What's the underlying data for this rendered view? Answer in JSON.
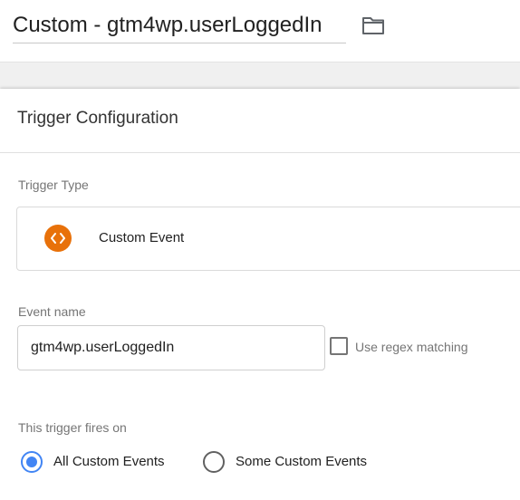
{
  "header": {
    "trigger_name": "Custom - gtm4wp.userLoggedIn",
    "folder_icon": "folder-icon"
  },
  "card": {
    "title": "Trigger Configuration",
    "trigger_type": {
      "label": "Trigger Type",
      "value": "Custom Event",
      "icon": "code-brackets-icon",
      "icon_color": "#e8710a"
    },
    "event_name": {
      "label": "Event name",
      "value": "gtm4wp.userLoggedIn",
      "regex_label": "Use regex matching",
      "regex_checked": false
    },
    "fires_on": {
      "label": "This trigger fires on",
      "options": [
        "All Custom Events",
        "Some Custom Events"
      ],
      "selected": "All Custom Events",
      "accent_color": "#4285f4"
    }
  }
}
